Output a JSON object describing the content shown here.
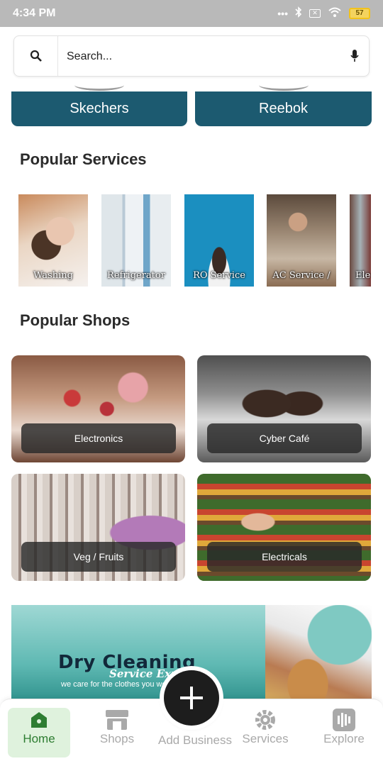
{
  "status_bar": {
    "time": "4:34 PM",
    "battery": "57",
    "sim": "✕"
  },
  "search": {
    "placeholder": "Search..."
  },
  "brands": [
    {
      "label": "Skechers"
    },
    {
      "label": "Reebok"
    }
  ],
  "popular_services": {
    "title": "Popular Services",
    "items": [
      {
        "label": "Washing"
      },
      {
        "label": "Refrigerator"
      },
      {
        "label": "RO Service"
      },
      {
        "label": "AC Service /"
      },
      {
        "label": "Ele"
      }
    ]
  },
  "popular_shops": {
    "title": "Popular Shops",
    "items": [
      {
        "label": "Electronics"
      },
      {
        "label": "Cyber Café"
      },
      {
        "label": "Veg / Fruits"
      },
      {
        "label": "Electricals"
      }
    ]
  },
  "banner": {
    "title": "Dry Cleaning",
    "subtitle": "Service Experts",
    "tagline": "we care for the clothes you wear"
  },
  "bottom_nav": {
    "home": "Home",
    "shops": "Shops",
    "add": "Add Business",
    "services": "Services",
    "explore": "Explore"
  },
  "colors": {
    "brand_button": "#1c5a70",
    "nav_active_bg": "#dff2dd",
    "nav_active_text": "#2e7d32",
    "status_bar": "#b9b9b9"
  }
}
